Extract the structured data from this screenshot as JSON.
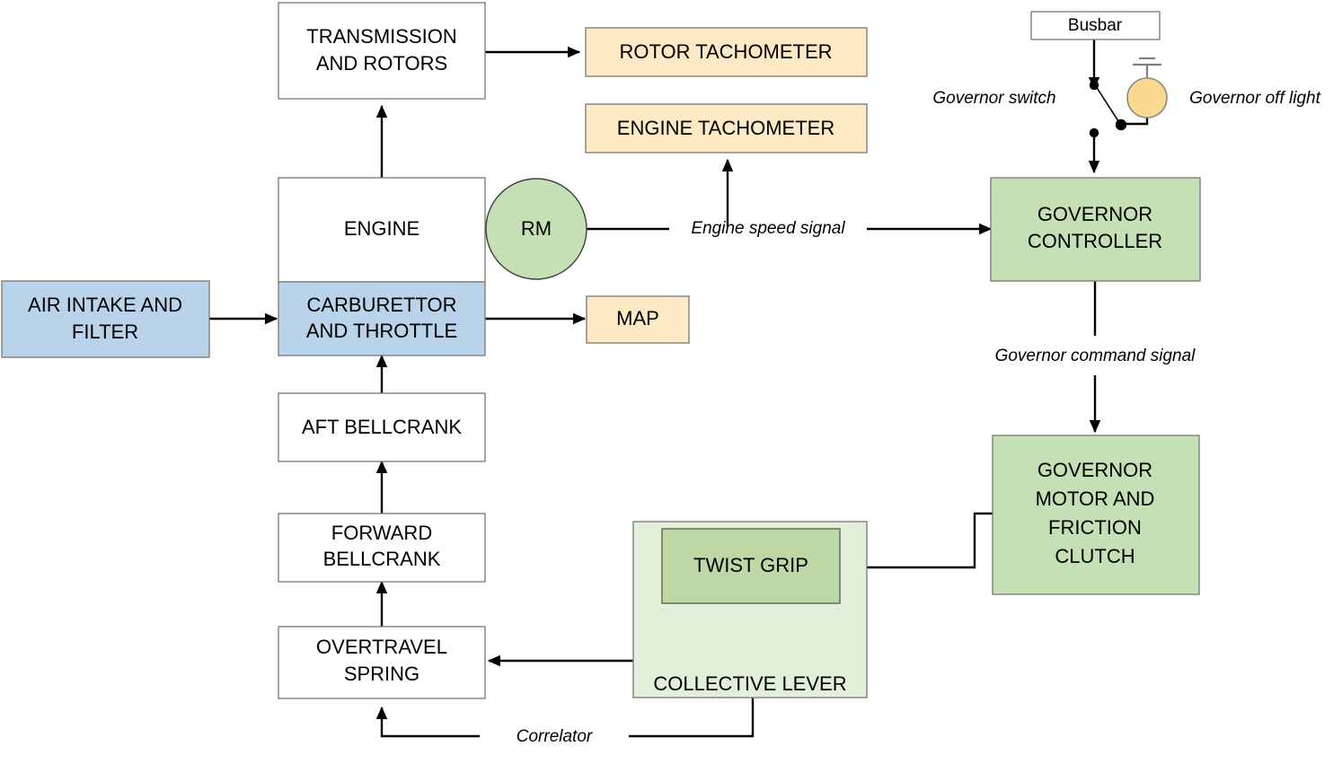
{
  "diagram": {
    "title": "Helicopter engine and governor control block diagram",
    "colors": {
      "blue_fill": "#b9d4ea",
      "blue_stroke": "#7f7f7f",
      "cream_fill": "#fdeac4",
      "cream_stroke": "#7f7f7f",
      "green_fill": "#c5e0b4",
      "green_stroke": "#7f7f7f",
      "green_dark_fill": "#bdd7a5",
      "green_pale_fill": "#e2efd9",
      "white_fill": "#ffffff",
      "white_stroke": "#7f7f7f",
      "lamp_fill": "#fbd98f",
      "lamp_stroke": "#7f7f7f",
      "line": "#000000"
    },
    "nodes": [
      {
        "id": "transmission_and_rotors",
        "label_lines": [
          "TRANSMISSION",
          "AND ROTORS"
        ],
        "style": "white"
      },
      {
        "id": "rotor_tachometer",
        "label_lines": [
          "ROTOR TACHOMETER"
        ],
        "style": "cream"
      },
      {
        "id": "engine_tachometer",
        "label_lines": [
          "ENGINE TACHOMETER"
        ],
        "style": "cream"
      },
      {
        "id": "engine",
        "label_lines": [
          "ENGINE"
        ],
        "style": "white"
      },
      {
        "id": "carburettor_and_throttle",
        "label_lines": [
          "CARBURETTOR",
          "AND THROTTLE"
        ],
        "style": "blue"
      },
      {
        "id": "rm",
        "label_lines": [
          "RM"
        ],
        "style": "green-circle"
      },
      {
        "id": "map",
        "label_lines": [
          "MAP"
        ],
        "style": "cream"
      },
      {
        "id": "air_intake_and_filter",
        "label_lines": [
          "AIR INTAKE AND",
          "FILTER"
        ],
        "style": "blue"
      },
      {
        "id": "aft_bellcrank",
        "label_lines": [
          "AFT BELLCRANK"
        ],
        "style": "white"
      },
      {
        "id": "forward_bellcrank",
        "label_lines": [
          "FORWARD",
          "BELLCRANK"
        ],
        "style": "white"
      },
      {
        "id": "overtravel_spring",
        "label_lines": [
          "OVERTRAVEL",
          "SPRING"
        ],
        "style": "white"
      },
      {
        "id": "collective_lever",
        "label_lines": [
          "COLLECTIVE LEVER"
        ],
        "style": "green-pale"
      },
      {
        "id": "twist_grip",
        "label_lines": [
          "TWIST GRIP"
        ],
        "style": "green-dark"
      },
      {
        "id": "busbar",
        "label_lines": [
          "Busbar"
        ],
        "style": "white"
      },
      {
        "id": "governor_controller",
        "label_lines": [
          "GOVERNOR",
          "CONTROLLER"
        ],
        "style": "green"
      },
      {
        "id": "governor_motor_and_friction_clutch",
        "label_lines": [
          "GOVERNOR",
          "MOTOR AND",
          "FRICTION",
          "CLUTCH"
        ],
        "style": "green"
      }
    ],
    "labels": {
      "transmission_and_rotors_l1": "TRANSMISSION",
      "transmission_and_rotors_l2": "AND ROTORS",
      "rotor_tachometer": "ROTOR TACHOMETER",
      "engine_tachometer": "ENGINE TACHOMETER",
      "engine": "ENGINE",
      "carburettor_l1": "CARBURETTOR",
      "carburettor_l2": "AND THROTTLE",
      "rm": "RM",
      "map": "MAP",
      "air_intake_l1": "AIR INTAKE AND",
      "air_intake_l2": "FILTER",
      "aft_bellcrank": "AFT BELLCRANK",
      "forward_bellcrank_l1": "FORWARD",
      "forward_bellcrank_l2": "BELLCRANK",
      "overtravel_spring_l1": "OVERTRAVEL",
      "overtravel_spring_l2": "SPRING",
      "collective_lever": "COLLECTIVE LEVER",
      "twist_grip": "TWIST GRIP",
      "busbar": "Busbar",
      "governor_controller_l1": "GOVERNOR",
      "governor_controller_l2": "CONTROLLER",
      "governor_motor_l1": "GOVERNOR",
      "governor_motor_l2": "MOTOR AND",
      "governor_motor_l3": "FRICTION",
      "governor_motor_l4": "CLUTCH"
    },
    "annotations": {
      "governor_switch": "Governor switch",
      "governor_off_light": "Governor off light",
      "engine_speed_signal": "Engine speed signal",
      "governor_command_signal": "Governor command signal",
      "correlator": "Correlator"
    },
    "connections": [
      {
        "from": "transmission_and_rotors",
        "to": "rotor_tachometer",
        "kind": "arrow"
      },
      {
        "from": "engine",
        "to": "transmission_and_rotors",
        "kind": "arrow"
      },
      {
        "from": "rm",
        "to": "governor_controller",
        "kind": "arrow",
        "label": "Engine speed signal"
      },
      {
        "from": "engine_speed_signal",
        "to": "engine_tachometer",
        "kind": "arrow"
      },
      {
        "from": "air_intake_and_filter",
        "to": "carburettor_and_throttle",
        "kind": "arrow"
      },
      {
        "from": "carburettor_and_throttle",
        "to": "map",
        "kind": "arrow"
      },
      {
        "from": "aft_bellcrank",
        "to": "carburettor_and_throttle",
        "kind": "arrow"
      },
      {
        "from": "forward_bellcrank",
        "to": "aft_bellcrank",
        "kind": "arrow"
      },
      {
        "from": "overtravel_spring",
        "to": "forward_bellcrank",
        "kind": "arrow"
      },
      {
        "from": "twist_grip",
        "to": "overtravel_spring",
        "kind": "arrow"
      },
      {
        "from": "collective_lever",
        "to": "overtravel_spring",
        "kind": "arrow",
        "label": "Correlator"
      },
      {
        "from": "busbar",
        "to": "governor_switch",
        "kind": "arrow"
      },
      {
        "from": "governor_switch",
        "to": "governor_controller",
        "kind": "arrow"
      },
      {
        "from": "governor_switch",
        "to": "governor_off_light",
        "kind": "line"
      },
      {
        "from": "governor_controller",
        "to": "governor_motor_and_friction_clutch",
        "kind": "arrow",
        "label": "Governor command signal"
      },
      {
        "from": "governor_motor_and_friction_clutch",
        "to": "twist_grip",
        "kind": "arrow"
      }
    ]
  }
}
